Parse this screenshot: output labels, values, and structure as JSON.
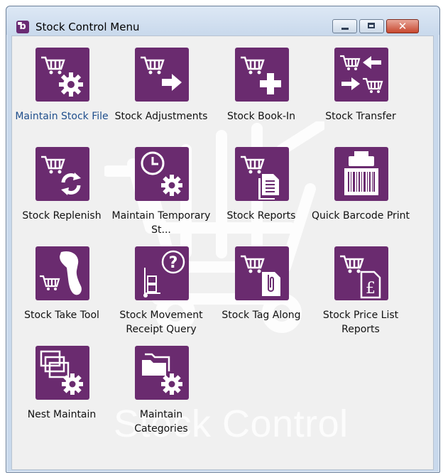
{
  "window": {
    "title": "Stock Control Menu",
    "app_icon_letter": "b",
    "watermark": "Stock Control",
    "controls": {
      "close_glyph": "✕"
    }
  },
  "menu": {
    "items": [
      {
        "label": "Maintain Stock File",
        "icon": "cart-gear-icon"
      },
      {
        "label": "Stock Adjustments",
        "icon": "cart-arrow-right-icon"
      },
      {
        "label": "Stock Book-In",
        "icon": "cart-plus-icon"
      },
      {
        "label": "Stock Transfer",
        "icon": "cart-transfer-icon"
      },
      {
        "label": "Stock Replenish",
        "icon": "cart-refresh-icon"
      },
      {
        "label": "Maintain Temporary St...",
        "icon": "clock-gear-icon"
      },
      {
        "label": "Stock Reports",
        "icon": "cart-report-icon"
      },
      {
        "label": "Quick Barcode Print",
        "icon": "barcode-printer-icon"
      },
      {
        "label": "Stock Take Tool",
        "icon": "barcode-scanner-icon"
      },
      {
        "label": "Stock Movement Receipt Query",
        "icon": "trolley-question-icon"
      },
      {
        "label": "Stock Tag Along",
        "icon": "cart-attachment-icon"
      },
      {
        "label": "Stock Price List Reports",
        "icon": "cart-pound-document-icon"
      },
      {
        "label": "Nest Maintain",
        "icon": "nested-windows-gear-icon"
      },
      {
        "label": "Maintain Categories",
        "icon": "folders-gear-icon"
      }
    ]
  }
}
